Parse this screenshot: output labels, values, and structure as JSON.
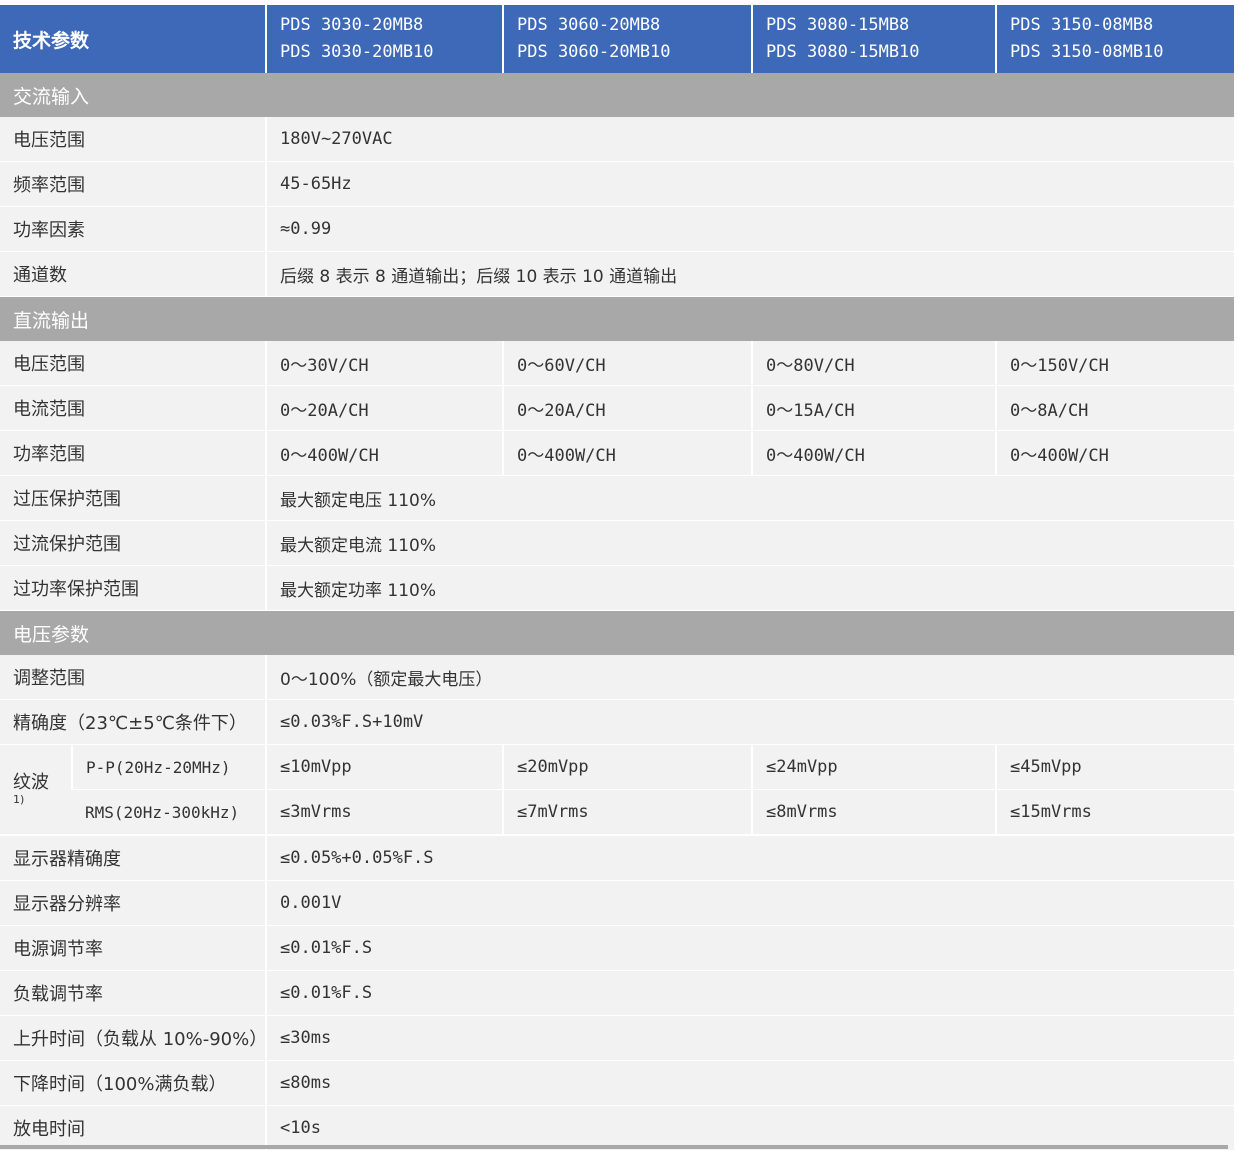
{
  "header": {
    "label": "技术参数",
    "models": [
      {
        "line1": "PDS 3030-20MB8",
        "line2": "PDS 3030-20MB10"
      },
      {
        "line1": "PDS 3060-20MB8",
        "line2": "PDS 3060-20MB10"
      },
      {
        "line1": "PDS 3080-15MB8",
        "line2": "PDS 3080-15MB10"
      },
      {
        "line1": "PDS 3150-08MB8",
        "line2": "PDS 3150-08MB10"
      }
    ]
  },
  "ac_input": {
    "title": "交流输入",
    "rows": [
      {
        "label": "电压范围",
        "value": "180V~270VAC"
      },
      {
        "label": "频率范围",
        "value": "45-65Hz"
      },
      {
        "label": "功率因素",
        "value": "≈0.99"
      },
      {
        "label": "通道数",
        "value": "后缀 8 表示 8 通道输出；后缀 10 表示 10 通道输出"
      }
    ]
  },
  "dc_output": {
    "title": "直流输出",
    "rows4": [
      {
        "label": "电压范围",
        "values": [
          "0～30V/CH",
          "0～60V/CH",
          "0～80V/CH",
          "0～150V/CH"
        ]
      },
      {
        "label": "电流范围",
        "values": [
          "0～20A/CH",
          "0～20A/CH",
          "0～15A/CH",
          "0～8A/CH"
        ]
      },
      {
        "label": "功率范围",
        "values": [
          "0～400W/CH",
          "0～400W/CH",
          "0～400W/CH",
          "0～400W/CH"
        ]
      }
    ],
    "rows1": [
      {
        "label": "过压保护范围",
        "value": "最大额定电压 110%"
      },
      {
        "label": "过流保护范围",
        "value": "最大额定电流 110%"
      },
      {
        "label": "过功率保护范围",
        "value": "最大额定功率 110%"
      }
    ]
  },
  "voltage_params": {
    "title": "电压参数",
    "rows_top": [
      {
        "label": "调整范围",
        "value": "0～100%（额定最大电压）"
      },
      {
        "label": "精确度（23℃±5℃条件下）",
        "value": "≤0.03%F.S+10mV"
      }
    ],
    "ripple": {
      "label": "纹波",
      "note": "1)",
      "pp": {
        "label": "P-P(20Hz-20MHz)",
        "values": [
          "≤10mVpp",
          "≤20mVpp",
          "≤24mVpp",
          "≤45mVpp"
        ]
      },
      "rms": {
        "label": "RMS(20Hz-300kHz)",
        "values": [
          "≤3mVrms",
          "≤7mVrms",
          "≤8mVrms",
          "≤15mVrms"
        ]
      }
    },
    "rows_bottom": [
      {
        "label": "显示器精确度",
        "value": "≤0.05%+0.05%F.S"
      },
      {
        "label": "显示器分辨率",
        "value": "0.001V"
      },
      {
        "label": "电源调节率",
        "value": "≤0.01%F.S"
      },
      {
        "label": "负载调节率",
        "value": "≤0.01%F.S"
      },
      {
        "label": "上升时间（负载从 10%-90%）",
        "value": "≤30ms"
      },
      {
        "label": "下降时间（100%满负载）",
        "value": "≤80ms"
      },
      {
        "label": "放电时间",
        "value": "<10s"
      }
    ]
  }
}
